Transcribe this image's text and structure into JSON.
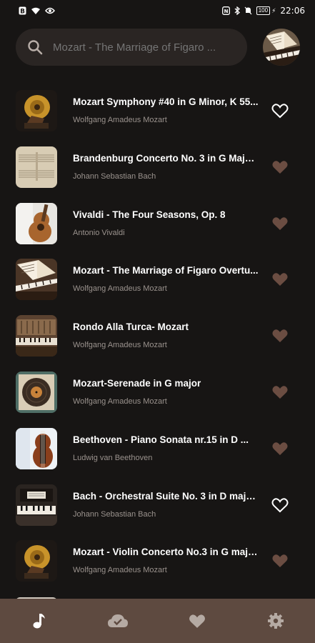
{
  "status_bar": {
    "time": "22:06",
    "battery": "100",
    "icons": [
      "b-icon",
      "wifi-icon",
      "eye-icon",
      "nfc-icon",
      "bluetooth-icon",
      "mute-icon",
      "battery-icon"
    ]
  },
  "search": {
    "placeholder": "Mozart - The Marriage of Figaro ..."
  },
  "songs": [
    {
      "title": "Mozart Symphony #40 in G Minor, K 55...",
      "artist": "Wolfgang Amadeus Mozart",
      "favorited": true,
      "thumb": "gramophone"
    },
    {
      "title": "Brandenburg Concerto No. 3 in G Major...",
      "artist": "Johann Sebastian Bach",
      "favorited": false,
      "thumb": "sheet-music"
    },
    {
      "title": "Vivaldi - The Four Seasons, Op. 8",
      "artist": "Antonio Vivaldi",
      "favorited": false,
      "thumb": "guitar"
    },
    {
      "title": "Mozart - The Marriage of Figaro Overtu...",
      "artist": "Wolfgang Amadeus Mozart",
      "favorited": false,
      "thumb": "piano-book"
    },
    {
      "title": "Rondo Alla Turca- Mozart",
      "artist": "Wolfgang Amadeus Mozart",
      "favorited": false,
      "thumb": "old-piano"
    },
    {
      "title": "Mozart-Serenade in G major",
      "artist": "Wolfgang Amadeus Mozart",
      "favorited": false,
      "thumb": "vinyl"
    },
    {
      "title": "Beethoven - Piano Sonata nr.15 in D ...",
      "artist": "Ludwig van Beethoven",
      "favorited": false,
      "thumb": "violin"
    },
    {
      "title": "Bach - Orchestral Suite No. 3 in D major...",
      "artist": "Johann Sebastian Bach",
      "favorited": true,
      "thumb": "upright-piano"
    },
    {
      "title": "Mozart - Violin Concerto No.3 in G majo...",
      "artist": "Wolfgang Amadeus Mozart",
      "favorited": false,
      "thumb": "gramophone"
    }
  ],
  "bottom_nav": [
    {
      "icon": "music-note-icon",
      "active": true
    },
    {
      "icon": "cloud-download-icon",
      "active": false
    },
    {
      "icon": "heart-icon",
      "active": false
    },
    {
      "icon": "settings-icon",
      "active": false
    }
  ],
  "colors": {
    "background": "#171514",
    "search_bg": "#2a2523",
    "nav_bg": "#5e4a40",
    "heart_inactive": "#6b4d42",
    "heart_active": "#ffffff",
    "artist_text": "#9a928d"
  }
}
